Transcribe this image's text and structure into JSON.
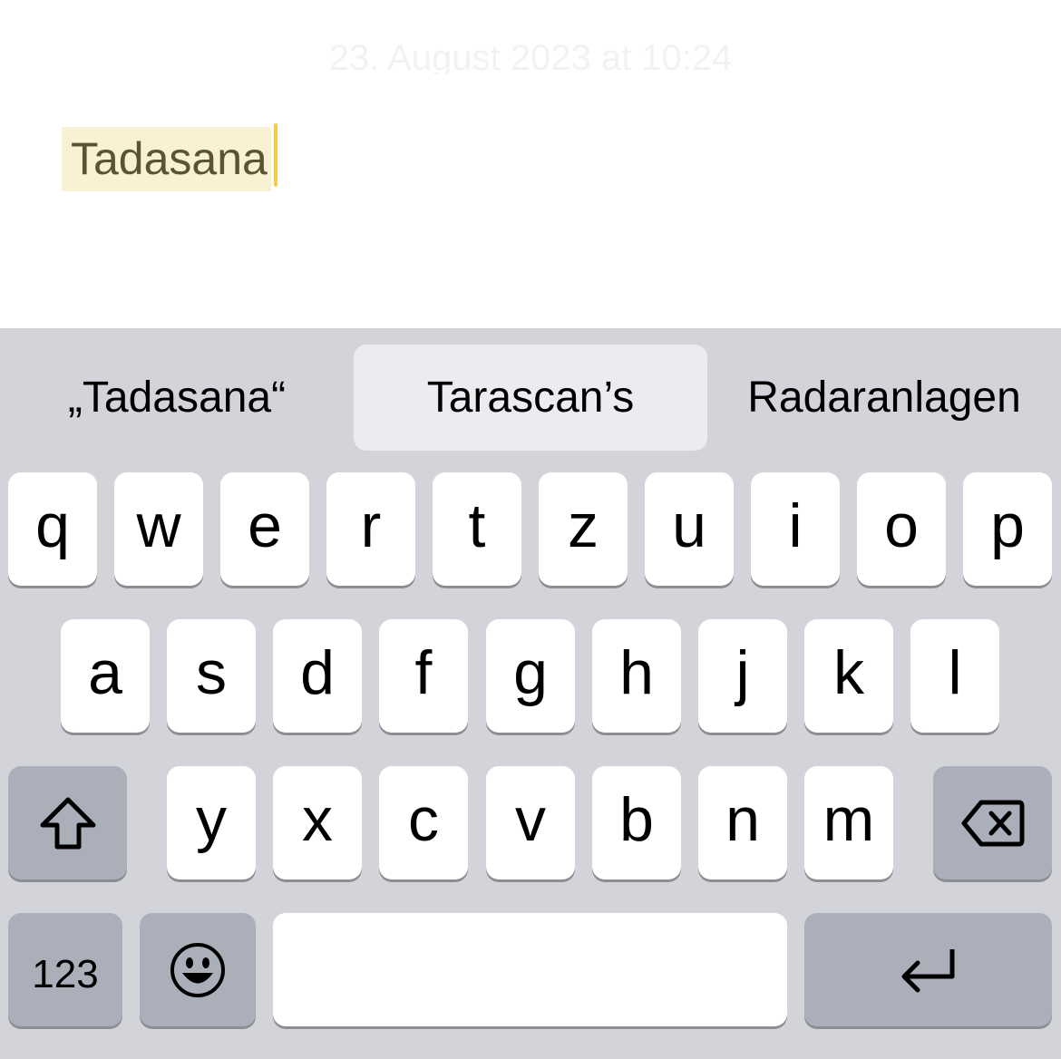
{
  "note": {
    "date_line": "23. August 2023 at 10:24",
    "text": "Tadasana"
  },
  "keyboard": {
    "suggestions": [
      "„Tadasana“",
      "Tarascan’s",
      "Radaranlagen"
    ],
    "row1": [
      "q",
      "w",
      "e",
      "r",
      "t",
      "z",
      "u",
      "i",
      "o",
      "p"
    ],
    "row2": [
      "a",
      "s",
      "d",
      "f",
      "g",
      "h",
      "j",
      "k",
      "l"
    ],
    "row3": [
      "y",
      "x",
      "c",
      "v",
      "b",
      "n",
      "m"
    ],
    "numbers_label": "123",
    "icons": {
      "shift": "shift-icon",
      "delete": "delete-icon",
      "emoji": "emoji-icon",
      "return": "return-icon"
    }
  }
}
